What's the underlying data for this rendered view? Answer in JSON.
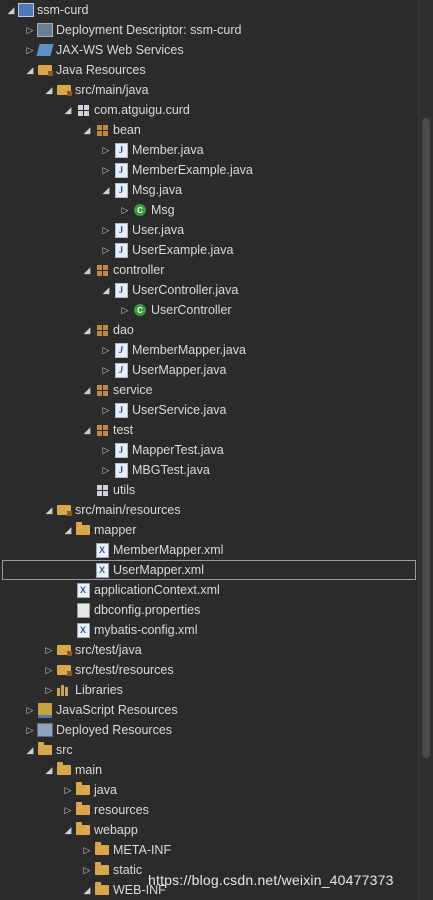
{
  "tree": [
    {
      "label": "ssm-curd",
      "depth": 0,
      "arrow": "open",
      "icon": "project-icon"
    },
    {
      "label": "Deployment Descriptor: ssm-curd",
      "depth": 1,
      "arrow": "closed",
      "icon": "deployment-descriptor-icon"
    },
    {
      "label": "JAX-WS Web Services",
      "depth": 1,
      "arrow": "closed",
      "icon": "web-services-icon"
    },
    {
      "label": "Java Resources",
      "depth": 1,
      "arrow": "open",
      "icon": "java-resources-icon"
    },
    {
      "label": "src/main/java",
      "depth": 2,
      "arrow": "open",
      "icon": "source-folder-icon"
    },
    {
      "label": "com.atguigu.curd",
      "depth": 3,
      "arrow": "open",
      "icon": "package-white-icon"
    },
    {
      "label": "bean",
      "depth": 4,
      "arrow": "open",
      "icon": "package-icon"
    },
    {
      "label": "Member.java",
      "depth": 5,
      "arrow": "closed",
      "icon": "java-file-icon"
    },
    {
      "label": "MemberExample.java",
      "depth": 5,
      "arrow": "closed",
      "icon": "java-file-icon"
    },
    {
      "label": "Msg.java",
      "depth": 5,
      "arrow": "open",
      "icon": "java-file-icon"
    },
    {
      "label": "Msg",
      "depth": 6,
      "arrow": "closed",
      "icon": "class-icon"
    },
    {
      "label": "User.java",
      "depth": 5,
      "arrow": "closed",
      "icon": "java-file-icon"
    },
    {
      "label": "UserExample.java",
      "depth": 5,
      "arrow": "closed",
      "icon": "java-file-icon"
    },
    {
      "label": "controller",
      "depth": 4,
      "arrow": "open",
      "icon": "package-icon"
    },
    {
      "label": "UserController.java",
      "depth": 5,
      "arrow": "open",
      "icon": "java-file-icon"
    },
    {
      "label": "UserController",
      "depth": 6,
      "arrow": "closed",
      "icon": "class-icon"
    },
    {
      "label": "dao",
      "depth": 4,
      "arrow": "open",
      "icon": "package-icon"
    },
    {
      "label": "MemberMapper.java",
      "depth": 5,
      "arrow": "closed",
      "icon": "java-interface-icon"
    },
    {
      "label": "UserMapper.java",
      "depth": 5,
      "arrow": "closed",
      "icon": "java-interface-icon"
    },
    {
      "label": "service",
      "depth": 4,
      "arrow": "open",
      "icon": "package-icon"
    },
    {
      "label": "UserService.java",
      "depth": 5,
      "arrow": "closed",
      "icon": "java-file-icon"
    },
    {
      "label": "test",
      "depth": 4,
      "arrow": "open",
      "icon": "package-icon"
    },
    {
      "label": "MapperTest.java",
      "depth": 5,
      "arrow": "closed",
      "icon": "java-file-icon"
    },
    {
      "label": "MBGTest.java",
      "depth": 5,
      "arrow": "closed",
      "icon": "java-file-icon"
    },
    {
      "label": "utils",
      "depth": 4,
      "arrow": "none",
      "icon": "package-white-icon"
    },
    {
      "label": "src/main/resources",
      "depth": 2,
      "arrow": "open",
      "icon": "source-folder-icon"
    },
    {
      "label": "mapper",
      "depth": 3,
      "arrow": "open",
      "icon": "folder-icon"
    },
    {
      "label": "MemberMapper.xml",
      "depth": 4,
      "arrow": "none",
      "icon": "xml-file-icon"
    },
    {
      "label": "UserMapper.xml",
      "depth": 4,
      "arrow": "none",
      "icon": "xml-file-icon",
      "selected": true
    },
    {
      "label": "applicationContext.xml",
      "depth": 3,
      "arrow": "none",
      "icon": "xml-file-icon"
    },
    {
      "label": "dbconfig.properties",
      "depth": 3,
      "arrow": "none",
      "icon": "properties-file-icon"
    },
    {
      "label": "mybatis-config.xml",
      "depth": 3,
      "arrow": "none",
      "icon": "xml-file-icon"
    },
    {
      "label": "src/test/java",
      "depth": 2,
      "arrow": "closed",
      "icon": "source-folder-icon"
    },
    {
      "label": "src/test/resources",
      "depth": 2,
      "arrow": "closed",
      "icon": "source-folder-icon"
    },
    {
      "label": "Libraries",
      "depth": 2,
      "arrow": "closed",
      "icon": "libraries-icon"
    },
    {
      "label": "JavaScript Resources",
      "depth": 1,
      "arrow": "closed",
      "icon": "javascript-resources-icon"
    },
    {
      "label": "Deployed Resources",
      "depth": 1,
      "arrow": "closed",
      "icon": "deployed-resources-icon"
    },
    {
      "label": "src",
      "depth": 1,
      "arrow": "open",
      "icon": "folder-icon"
    },
    {
      "label": "main",
      "depth": 2,
      "arrow": "open",
      "icon": "folder-icon"
    },
    {
      "label": "java",
      "depth": 3,
      "arrow": "closed",
      "icon": "folder-icon"
    },
    {
      "label": "resources",
      "depth": 3,
      "arrow": "closed",
      "icon": "folder-icon"
    },
    {
      "label": "webapp",
      "depth": 3,
      "arrow": "open",
      "icon": "folder-icon"
    },
    {
      "label": "META-INF",
      "depth": 4,
      "arrow": "closed",
      "icon": "folder-icon"
    },
    {
      "label": "static",
      "depth": 4,
      "arrow": "closed",
      "icon": "folder-icon"
    },
    {
      "label": "WEB-INF",
      "depth": 4,
      "arrow": "open",
      "icon": "folder-icon"
    }
  ],
  "watermark": "https://blog.csdn.net/weixin_40477373",
  "colors": {
    "background": "#2b2b2b",
    "text": "#d9d9d9",
    "package": "#c08a3e",
    "folder": "#d9a64a",
    "class": "#3b9a3b"
  }
}
